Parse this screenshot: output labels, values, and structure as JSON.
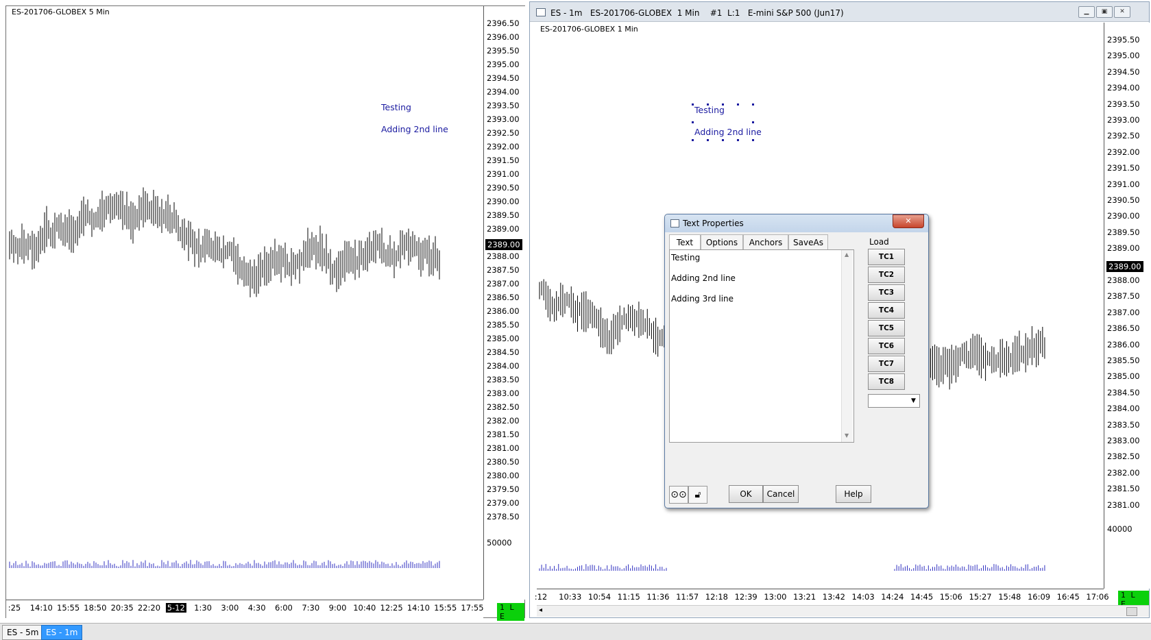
{
  "left_chart": {
    "title": "ES-201706-GLOBEX 5 Min",
    "price_labels": [
      "2396.50",
      "2396.00",
      "2395.50",
      "2395.00",
      "2394.50",
      "2394.00",
      "2393.50",
      "2393.00",
      "2392.50",
      "2392.00",
      "2391.50",
      "2391.00",
      "2390.50",
      "2390.00",
      "2389.50",
      "2389.00",
      "2388.50",
      "2388.00",
      "2387.50",
      "2387.00",
      "2386.50",
      "2386.00",
      "2385.50",
      "2385.00",
      "2384.50",
      "2384.00",
      "2383.50",
      "2383.00",
      "2382.50",
      "2382.00",
      "2381.50",
      "2381.00",
      "2380.50",
      "2380.00",
      "2379.50",
      "2379.00",
      "2378.50"
    ],
    "volume_label": "50000",
    "time_labels": [
      ":25",
      "14:10",
      "15:55",
      "18:50",
      "20:35",
      "22:20",
      "5-12",
      "1:30",
      "3:00",
      "4:30",
      "6:00",
      "7:30",
      "9:00",
      "10:40",
      "12:25",
      "14:10",
      "15:55",
      "17:55"
    ],
    "current_price": "2389.00",
    "status": "1 L E",
    "text_line1": "Testing",
    "text_line2": "Adding 2nd line"
  },
  "right_window": {
    "title": "ES - 1m   ES-201706-GLOBEX  1 Min    #1  L:1   E-mini S&P 500 (Jun17)",
    "buttons": [
      "minimize-icon",
      "restore-icon",
      "close-icon"
    ]
  },
  "right_chart": {
    "title": "ES-201706-GLOBEX 1 Min",
    "price_labels": [
      "2395.50",
      "2395.00",
      "2394.50",
      "2394.00",
      "2393.50",
      "2393.00",
      "2392.50",
      "2392.00",
      "2391.50",
      "2391.00",
      "2390.50",
      "2390.00",
      "2389.50",
      "2389.00",
      "2388.50",
      "2388.00",
      "2387.50",
      "2387.00",
      "2386.50",
      "2386.00",
      "2385.50",
      "2385.00",
      "2384.50",
      "2384.00",
      "2383.50",
      "2383.00",
      "2382.50",
      "2382.00",
      "2381.50",
      "2381.00"
    ],
    "volume_label": "40000",
    "time_labels": [
      ":12",
      "10:33",
      "10:54",
      "11:15",
      "11:36",
      "11:57",
      "12:18",
      "12:39",
      "13:00",
      "13:21",
      "13:42",
      "14:03",
      "14:24",
      "14:45",
      "15:06",
      "15:27",
      "15:48",
      "16:09",
      "16:45",
      "17:06"
    ],
    "current_price": "2389.00",
    "status": "1 L E",
    "text_line1": "Testing",
    "text_line2": "Adding 2nd line"
  },
  "dialog": {
    "title": "Text Properties",
    "tabs": [
      "Text",
      "Options",
      "Anchors",
      "SaveAs"
    ],
    "load_label": "Load",
    "text_lines": [
      "Testing",
      "Adding 2nd line",
      "Adding 3rd line"
    ],
    "tc_buttons": [
      "TC1",
      "TC2",
      "TC3",
      "TC4",
      "TC5",
      "TC6",
      "TC7",
      "TC8"
    ],
    "ok": "OK",
    "cancel": "Cancel",
    "help": "Help"
  },
  "bottom_tabs": [
    "ES - 5m",
    "ES - 1m"
  ],
  "colors": {
    "text_tool": "#1a1aa0",
    "status_green": "#0bd00b",
    "active_tab": "#3399ff",
    "volume": "#3030c0"
  }
}
